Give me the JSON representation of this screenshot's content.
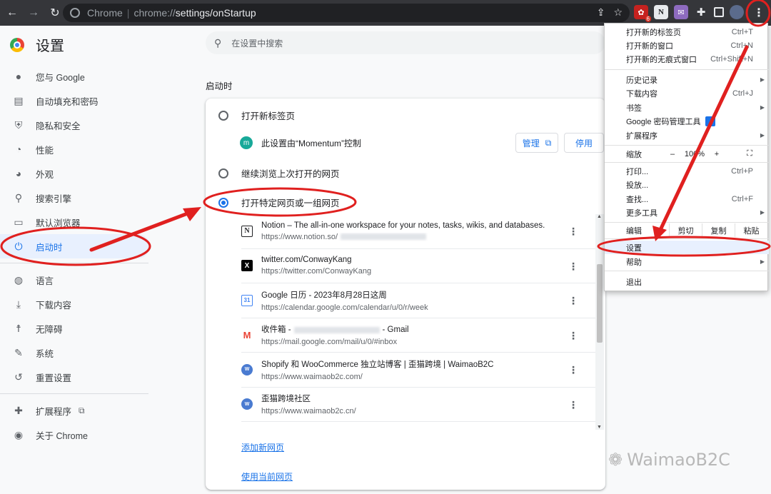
{
  "browser": {
    "site_label": "Chrome",
    "url_host": "chrome://",
    "url_path": "settings/onStartup",
    "ext_badge": "6"
  },
  "settings": {
    "title": "设置",
    "search_placeholder": "在设置中搜索"
  },
  "sidebar": {
    "items": [
      {
        "label": "您与 Google"
      },
      {
        "label": "自动填充和密码"
      },
      {
        "label": "隐私和安全"
      },
      {
        "label": "性能"
      },
      {
        "label": "外观"
      },
      {
        "label": "搜索引擎"
      },
      {
        "label": "默认浏览器"
      },
      {
        "label": "启动时"
      },
      {
        "label": "语言"
      },
      {
        "label": "下载内容"
      },
      {
        "label": "无障碍"
      },
      {
        "label": "系统"
      },
      {
        "label": "重置设置"
      },
      {
        "label": "扩展程序"
      },
      {
        "label": "关于 Chrome"
      }
    ]
  },
  "startup": {
    "section_title": "启动时",
    "option_new_tab": "打开新标签页",
    "controlled_by": "此设置由“Momentum”控制",
    "momentum_icon_letter": "m",
    "manage_label": "管理",
    "disable_label": "停用",
    "option_continue": "继续浏览上次打开的网页",
    "option_specific": "打开特定网页或一组网页",
    "pages": [
      {
        "title": "Notion – The all-in-one workspace for your notes, tasks, wikis, and databases.",
        "url": "https://www.notion.so/",
        "favicon": "N"
      },
      {
        "title": "twitter.com/ConwayKang",
        "url": "https://twitter.com/ConwayKang",
        "favicon": "X"
      },
      {
        "title": "Google 日历 - 2023年8月28日这周",
        "url": "https://calendar.google.com/calendar/u/0/r/week",
        "favicon": "31"
      },
      {
        "title_prefix": "收件箱 -",
        "title_suffix": "- Gmail",
        "url": "https://mail.google.com/mail/u/0/#inbox",
        "favicon": "M"
      },
      {
        "title": "Shopify 和 WooCommerce 独立站博客 | 歪猫跨境 | WaimaoB2C",
        "url": "https://www.waimaob2c.com/",
        "favicon": "W"
      },
      {
        "title": "歪猫跨境社区",
        "url": "https://www.waimaob2c.cn/",
        "favicon": "W"
      }
    ],
    "add_page": "添加新网页",
    "use_current": "使用当前网页"
  },
  "menu": {
    "new_tab": "打开新的标签页",
    "new_tab_sc": "Ctrl+T",
    "new_window": "打开新的窗口",
    "new_window_sc": "Ctrl+N",
    "incognito": "打开新的无痕式窗口",
    "incognito_sc": "Ctrl+Shift+N",
    "history": "历史记录",
    "downloads": "下载内容",
    "downloads_sc": "Ctrl+J",
    "bookmarks": "书签",
    "password_manager": "Google 密码管理工具",
    "extensions": "扩展程序",
    "zoom": "缩放",
    "zoom_minus": "–",
    "zoom_value": "100%",
    "zoom_plus": "+",
    "print": "打印...",
    "print_sc": "Ctrl+P",
    "cast": "投放...",
    "find": "查找...",
    "find_sc": "Ctrl+F",
    "more_tools": "更多工具",
    "edit": "编辑",
    "cut": "剪切",
    "copy": "复制",
    "paste": "粘贴",
    "settings": "设置",
    "help": "帮助",
    "exit": "退出"
  },
  "watermark": "WaimaoB2C",
  "colors": {
    "accent": "#1a73e8",
    "annotation": "#e0201f",
    "toolbar": "#35363a"
  }
}
